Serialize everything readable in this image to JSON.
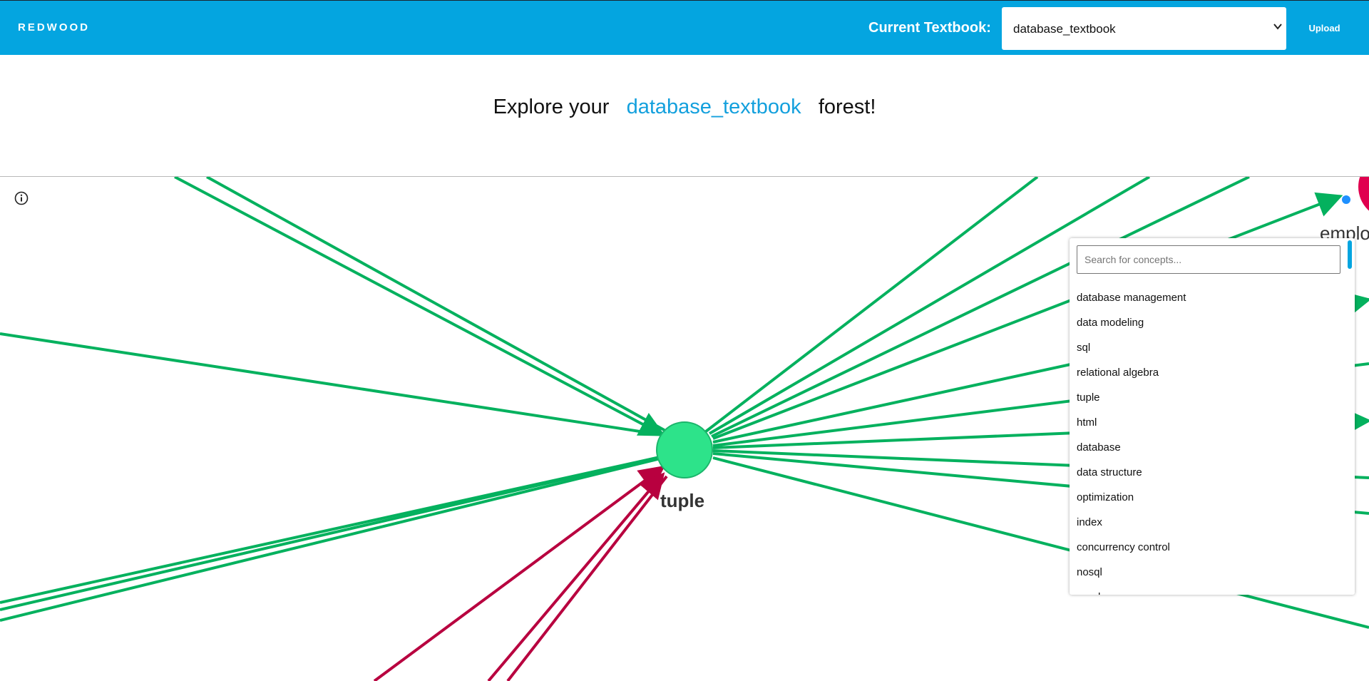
{
  "header": {
    "brand": "REDWOOD",
    "textbook_label": "Current Textbook:",
    "textbook_selected": "database_textbook",
    "upload_label": "Upload",
    "bar_color": "#04a5e0"
  },
  "headline": {
    "prefix": "Explore your",
    "book": "database_textbook",
    "suffix": "forest!"
  },
  "graph": {
    "center_node_label": "tuple",
    "partial_node_label": "emplo",
    "center_node_color": "#2de38a",
    "edge_color_outgoing": "#04b15e",
    "edge_color_incoming": "#b8003f",
    "partial_node_color": "#e0004f"
  },
  "concept_panel": {
    "search_placeholder": "Search for concepts...",
    "concepts": [
      "database management",
      "data modeling",
      "sql",
      "relational algebra",
      "tuple",
      "html",
      "database",
      "data structure",
      "optimization",
      "index",
      "concurrency control",
      "nosql",
      "graph"
    ]
  },
  "icons": {
    "info": "info-icon",
    "select_arrow": "chevron-down-icon"
  }
}
